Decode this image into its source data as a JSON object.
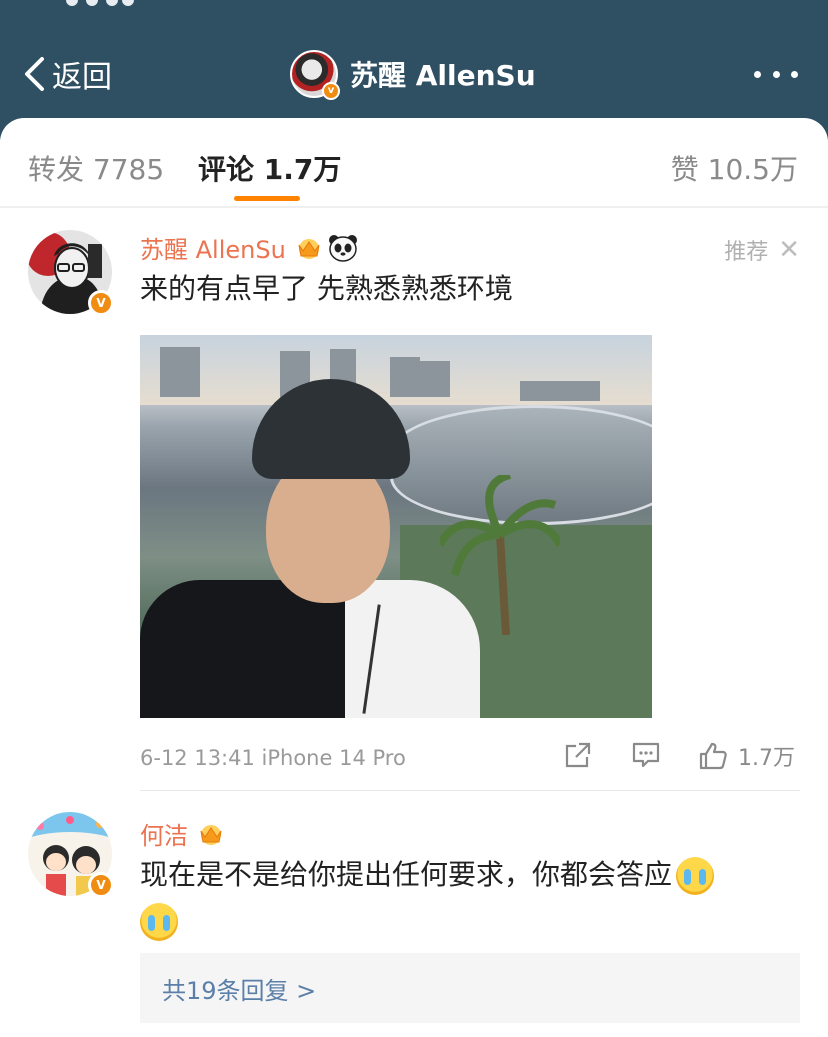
{
  "nav": {
    "back_label": "返回",
    "title": "苏醒 AllenSu",
    "bg_color": "#2f4f63"
  },
  "tabs": {
    "repost": "转发 7785",
    "comment": "评论 1.7万",
    "like": "赞 10.5万",
    "active": "comment",
    "accent": "#ff8200"
  },
  "comments": [
    {
      "username": "苏醒 AllenSu",
      "tag": "推荐",
      "text": "来的有点早了 先熟悉熟悉环境",
      "time_device": "6-12 13:41 iPhone 14 Pro",
      "like_count": "1.7万",
      "icons": [
        "crown-icon",
        "panda-icon",
        "verified-badge",
        "share-icon",
        "comment-icon",
        "like-icon",
        "close-icon"
      ]
    },
    {
      "username": "何洁",
      "text": "现在是不是给你提出任何要求，你都会答应",
      "replies_label": "共19条回复 >",
      "icons": [
        "crown-icon",
        "verified-badge",
        "crying-emoji"
      ]
    }
  ],
  "colors": {
    "username": "#eb7350",
    "verified": "#f08c12",
    "reply_link": "#5b7fa8"
  }
}
